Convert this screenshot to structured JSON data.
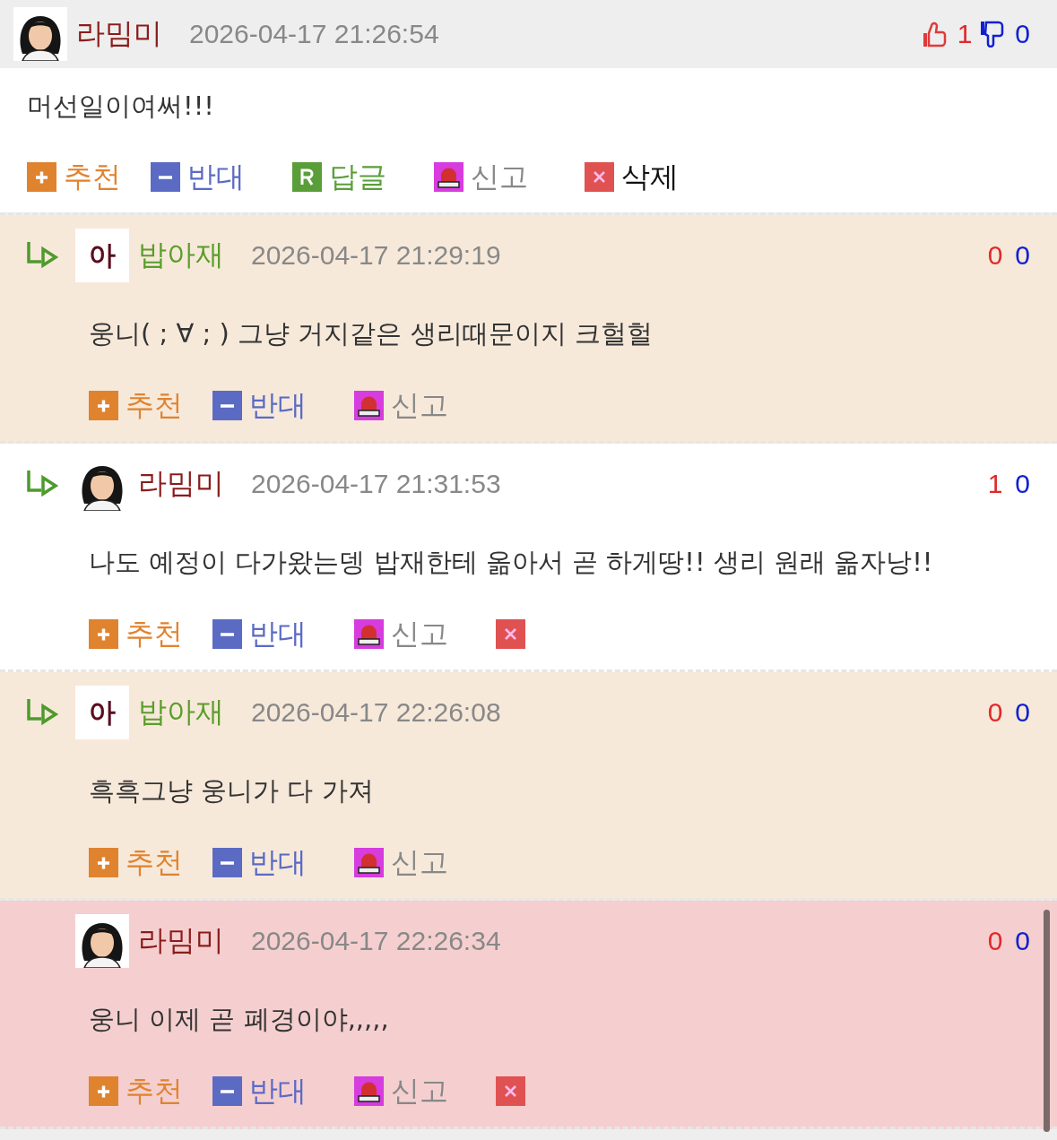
{
  "comments": [
    {
      "avatar": {
        "kind": "photo"
      },
      "author": {
        "name": "라밈미",
        "color": "#8b1c1c"
      },
      "time": "2026-04-17 21:26:54",
      "up": "1",
      "down": "0",
      "thumbs": true,
      "reply_arrow": false,
      "color": "#ffffff",
      "body": "머선일이여써!!!",
      "actions": [
        {
          "kind": "recommend",
          "label": "추천"
        },
        {
          "kind": "oppose",
          "label": "반대"
        },
        {
          "kind": "reply",
          "label": "답글"
        },
        {
          "kind": "report",
          "label": "신고"
        },
        {
          "kind": "delete",
          "label": "삭제"
        }
      ]
    },
    {
      "avatar": {
        "kind": "letter",
        "text": "아"
      },
      "author": {
        "name": "밥아재",
        "color": "#5a9e2a"
      },
      "time": "2026-04-17 21:29:19",
      "up": "0",
      "down": "0",
      "thumbs": false,
      "reply_arrow": true,
      "color": "#f7e9da",
      "body": "웅니(  ; ∀ ; ) 그냥 거지같은 생리때문이지 크헐헐",
      "actions": [
        {
          "kind": "recommend",
          "label": "추천"
        },
        {
          "kind": "oppose",
          "label": "반대"
        },
        {
          "kind": "report",
          "label": "신고"
        }
      ]
    },
    {
      "avatar": {
        "kind": "photo"
      },
      "author": {
        "name": "라밈미",
        "color": "#8b1c1c"
      },
      "time": "2026-04-17 21:31:53",
      "up": "1",
      "down": "0",
      "thumbs": false,
      "reply_arrow": true,
      "color": "#ffffff",
      "body": "나도 예정이 다가왔는뎅 밥재한테 옮아서 곧 하게땅!! 생리 원래 옮자낭!!",
      "actions": [
        {
          "kind": "recommend",
          "label": "추천"
        },
        {
          "kind": "oppose",
          "label": "반대"
        },
        {
          "kind": "report",
          "label": "신고"
        },
        {
          "kind": "delete"
        }
      ]
    },
    {
      "avatar": {
        "kind": "letter",
        "text": "아"
      },
      "author": {
        "name": "밥아재",
        "color": "#5a9e2a"
      },
      "time": "2026-04-17 22:26:08",
      "up": "0",
      "down": "0",
      "thumbs": false,
      "reply_arrow": true,
      "color": "#f7e9da",
      "body": "흑흑그냥 웅니가 다 가져",
      "actions": [
        {
          "kind": "recommend",
          "label": "추천"
        },
        {
          "kind": "oppose",
          "label": "반대"
        },
        {
          "kind": "report",
          "label": "신고"
        }
      ]
    },
    {
      "avatar": {
        "kind": "photo"
      },
      "author": {
        "name": "라밈미",
        "color": "#8b1c1c"
      },
      "time": "2026-04-17 22:26:34",
      "up": "0",
      "down": "0",
      "thumbs": false,
      "reply_arrow": false,
      "color": "#f5cfcf",
      "body": "웅니 이제 곧 폐경이야,,,,,",
      "actions": [
        {
          "kind": "recommend",
          "label": "추천"
        },
        {
          "kind": "oppose",
          "label": "반대"
        },
        {
          "kind": "report",
          "label": "신고"
        },
        {
          "kind": "delete"
        }
      ]
    }
  ]
}
